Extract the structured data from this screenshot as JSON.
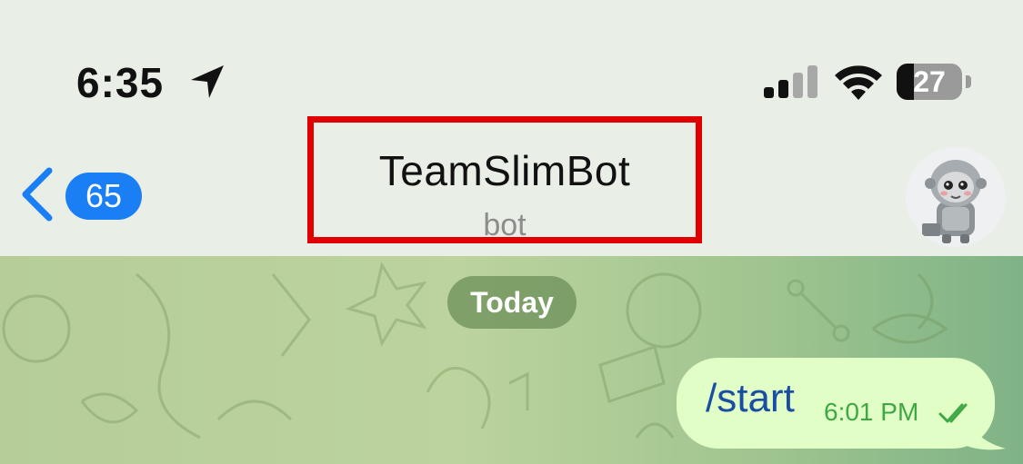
{
  "status_bar": {
    "time": "6:35",
    "battery_level": "27",
    "battery_fraction": 0.27,
    "icons": [
      "location-arrow-icon",
      "cellular-signal-icon",
      "wifi-icon",
      "battery-icon"
    ]
  },
  "header": {
    "back_badge_count": "65",
    "title": "TeamSlimBot",
    "subtitle": "bot",
    "icons": [
      "back-chevron-icon",
      "bot-avatar"
    ]
  },
  "chat": {
    "date_label": "Today",
    "messages": [
      {
        "text": "/start",
        "time": "6:01 PM",
        "status": "read",
        "outgoing": true
      }
    ]
  },
  "colors": {
    "accent": "#1a7ef5",
    "highlight_border": "#e00000",
    "bubble_bg": "#e1fec6",
    "message_text": "#1a4ea3",
    "message_time": "#3fa845"
  }
}
